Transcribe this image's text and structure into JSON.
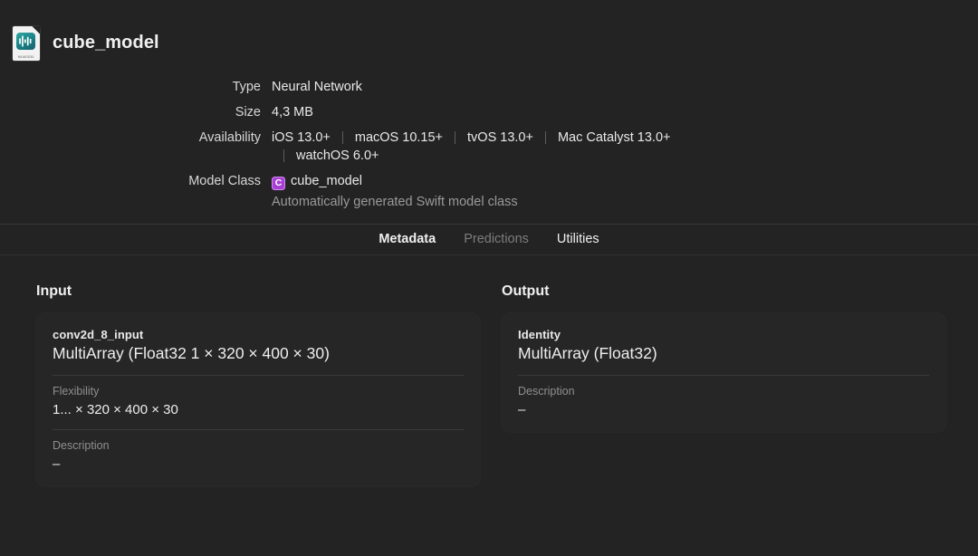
{
  "header": {
    "title": "cube_model",
    "icon": "mlmodel-document-icon",
    "icon_caption": "MLMODEL"
  },
  "info": {
    "rows": [
      {
        "label": "Type",
        "value": "Neural Network"
      },
      {
        "label": "Size",
        "value": "4,3 MB"
      }
    ],
    "availability": {
      "label": "Availability",
      "platforms": [
        "iOS 13.0+",
        "macOS 10.15+",
        "tvOS 13.0+",
        "Mac Catalyst 13.0+",
        "watchOS 6.0+"
      ]
    },
    "model_class": {
      "label": "Model Class",
      "badge": "C",
      "badge_color": "#a73fd4",
      "value": "cube_model",
      "note": "Automatically generated Swift model class"
    }
  },
  "tabs": [
    {
      "label": "Metadata",
      "state": "active"
    },
    {
      "label": "Predictions",
      "state": "disabled"
    },
    {
      "label": "Utilities",
      "state": "normal"
    }
  ],
  "input": {
    "section_title": "Input",
    "feature_name": "conv2d_8_input",
    "feature_type": "MultiArray (Float32 1 × 320 × 400 × 30)",
    "props": [
      {
        "label": "Flexibility",
        "value": "1... × 320 × 400 × 30"
      },
      {
        "label": "Description",
        "value": "–"
      }
    ]
  },
  "output": {
    "section_title": "Output",
    "feature_name": "Identity",
    "feature_type": "MultiArray (Float32)",
    "props": [
      {
        "label": "Description",
        "value": "–"
      }
    ]
  }
}
